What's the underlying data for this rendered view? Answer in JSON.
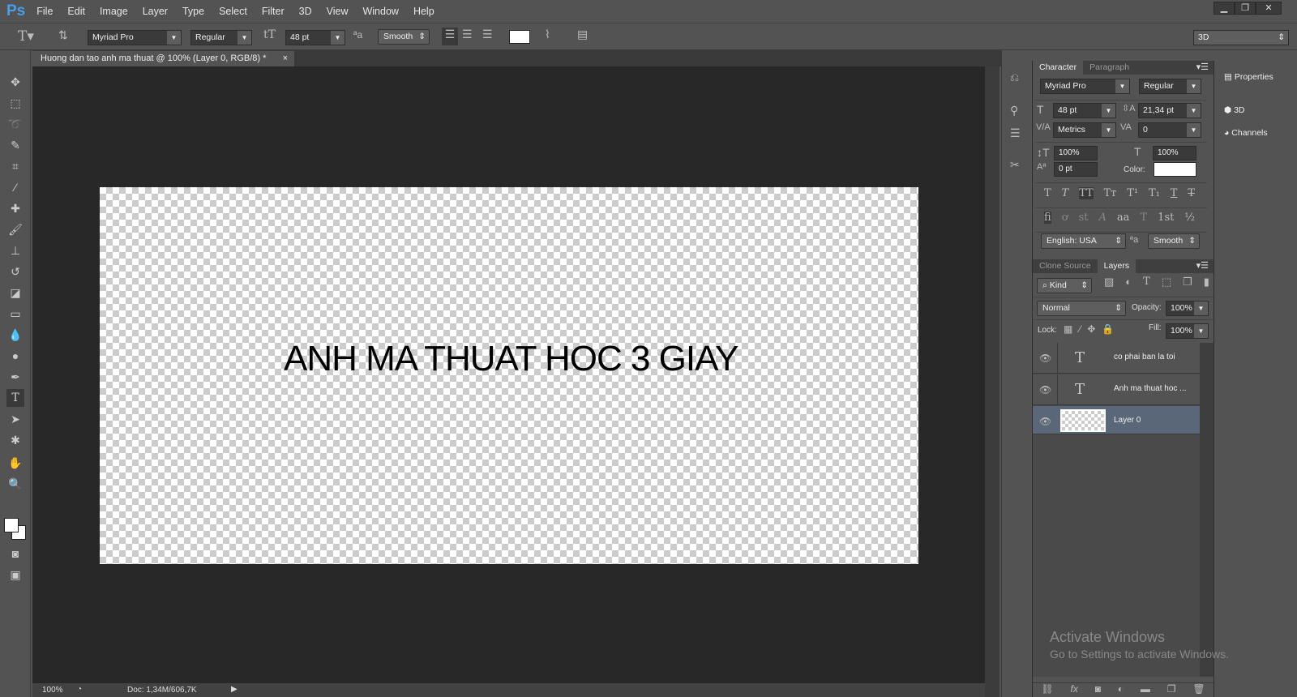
{
  "app": {
    "logo": "Ps",
    "menu": [
      "File",
      "Edit",
      "Image",
      "Layer",
      "Type",
      "Select",
      "Filter",
      "3D",
      "View",
      "Window",
      "Help"
    ],
    "window_controls": [
      "minimize",
      "restore",
      "close"
    ]
  },
  "options": {
    "font_family": "Myriad Pro",
    "font_style": "Regular",
    "font_size": "48 pt",
    "antialias": "Smooth",
    "text_color": "#ffffff",
    "workspace": "3D"
  },
  "document": {
    "tab_title": "Huong dan tao anh ma thuat @ 100% (Layer 0, RGB/8) *",
    "canvas_text": "ANH MA THUAT HOC 3 GIAY",
    "zoom": "100%",
    "doc_info": "Doc: 1,34M/606,7K"
  },
  "character": {
    "tabs": [
      "Character",
      "Paragraph"
    ],
    "font_family": "Myriad Pro",
    "font_style": "Regular",
    "size": "48 pt",
    "leading": "21,34 pt",
    "kerning": "Metrics",
    "tracking": "0",
    "vscale": "100%",
    "hscale": "100%",
    "baseline": "0 pt",
    "color_label": "Color:",
    "color": "#ffffff",
    "type_styles": [
      "T",
      "T",
      "TT",
      "Tт",
      "T¹",
      "T₁",
      "T",
      "T"
    ],
    "opentype": [
      "fi",
      "ơ",
      "st",
      "A",
      "aa",
      "T",
      "1st",
      "½"
    ],
    "language": "English: USA",
    "antialias": "Smooth"
  },
  "layers": {
    "tabs": [
      "Clone Source",
      "Layers"
    ],
    "filter": "Kind",
    "blend": "Normal",
    "opacity_label": "Opacity:",
    "opacity": "100%",
    "lock_label": "Lock:",
    "fill_label": "Fill:",
    "fill": "100%",
    "items": [
      {
        "name": "co phai ban la toi",
        "type": "text"
      },
      {
        "name": "Anh ma thuat hoc ...",
        "type": "text"
      },
      {
        "name": "Layer 0",
        "type": "pixel",
        "selected": true
      }
    ]
  },
  "right_panels": [
    "Properties",
    "3D",
    "Channels"
  ],
  "watermark": {
    "title": "Activate Windows",
    "subtitle": "Go to Settings to activate Windows."
  }
}
